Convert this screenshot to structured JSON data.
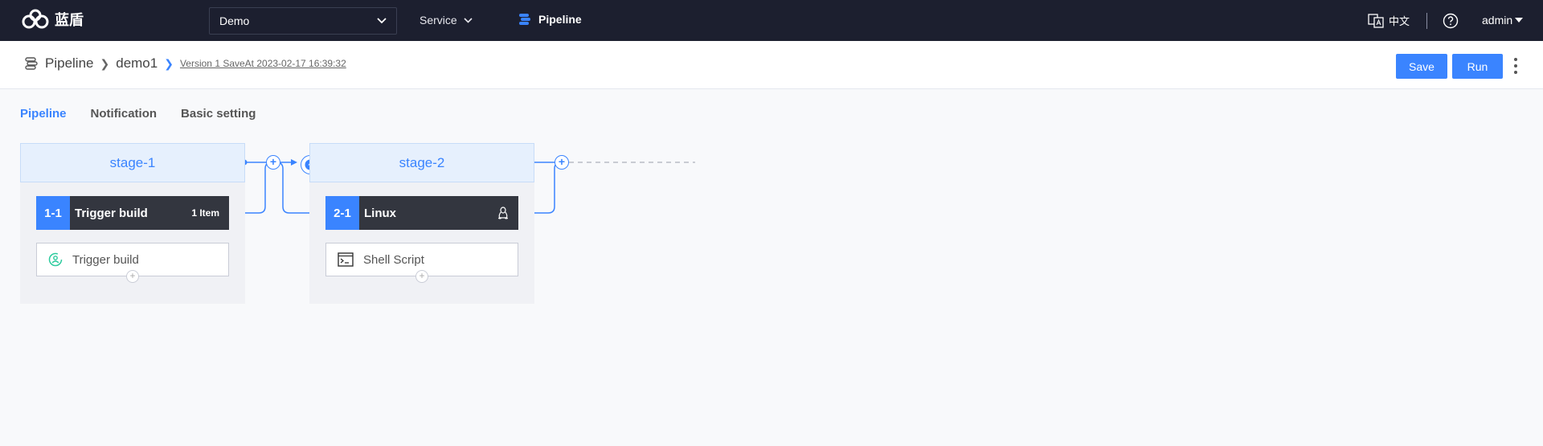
{
  "app": {
    "name": "蓝盾"
  },
  "topbar": {
    "project": "Demo",
    "service_label": "Service",
    "pipeline_label": "Pipeline",
    "lang_label": "中文",
    "user": "admin"
  },
  "breadcrumb": {
    "root": "Pipeline",
    "name": "demo1",
    "version": "Version 1 SaveAt 2023-02-17 16:39:32"
  },
  "actions": {
    "save": "Save",
    "run": "Run"
  },
  "tabs": [
    {
      "label": "Pipeline",
      "active": true
    },
    {
      "label": "Notification",
      "active": false
    },
    {
      "label": "Basic setting",
      "active": false
    }
  ],
  "stages": [
    {
      "name": "stage-1",
      "job": {
        "num": "1-1",
        "name": "Trigger build",
        "extra": "1 Item"
      },
      "element": {
        "name": "Trigger build",
        "icon": "trigger-icon"
      }
    },
    {
      "name": "stage-2",
      "job": {
        "num": "2-1",
        "name": "Linux",
        "extra": "",
        "icon": "linux-icon"
      },
      "element": {
        "name": "Shell Script",
        "icon": "terminal-icon"
      }
    }
  ],
  "colors": {
    "accent": "#3a84ff",
    "topbar": "#1c1f2f",
    "job": "#33363f"
  }
}
